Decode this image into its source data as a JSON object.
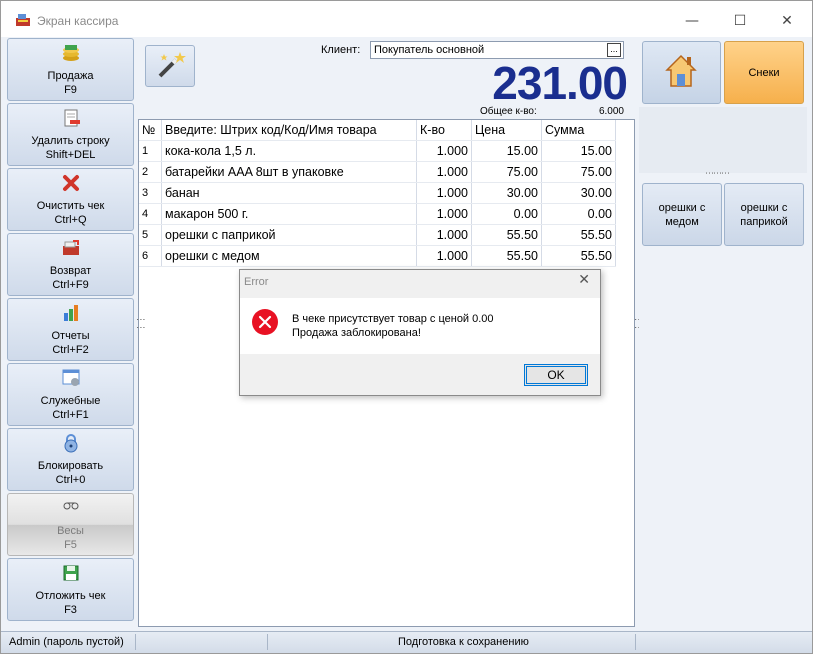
{
  "window": {
    "title": "Экран кассира",
    "minimize": "—",
    "maximize": "☐",
    "close": "✕"
  },
  "sidebar": {
    "items": [
      {
        "label": "Продажа",
        "shortcut": "F9"
      },
      {
        "label": "Удалить строку",
        "shortcut": "Shift+DEL"
      },
      {
        "label": "Очистить чек",
        "shortcut": "Ctrl+Q"
      },
      {
        "label": "Возврат",
        "shortcut": "Ctrl+F9"
      },
      {
        "label": "Отчеты",
        "shortcut": "Ctrl+F2"
      },
      {
        "label": "Служебные",
        "shortcut": "Ctrl+F1"
      },
      {
        "label": "Блокировать",
        "shortcut": "Ctrl+0"
      },
      {
        "label": "Весы",
        "shortcut": "F5"
      },
      {
        "label": "Отложить чек",
        "shortcut": "F3"
      }
    ]
  },
  "client": {
    "label": "Клиент:",
    "value": "Покупатель основной",
    "button": "..."
  },
  "total": {
    "amount": "231.00",
    "qty_label": "Общее к-во:",
    "qty_value": "6.000"
  },
  "table": {
    "headers": [
      "№",
      "Введите: Штрих код/Код/Имя товара",
      "К-во",
      "Цена",
      "Сумма"
    ],
    "rows": [
      [
        "1",
        "кока-кола 1,5 л.",
        "1.000",
        "15.00",
        "15.00"
      ],
      [
        "2",
        "батарейки AAA 8шт в упаковке",
        "1.000",
        "75.00",
        "75.00"
      ],
      [
        "3",
        "банан",
        "1.000",
        "30.00",
        "30.00"
      ],
      [
        "4",
        "макарон 500 г.",
        "1.000",
        "0.00",
        "0.00"
      ],
      [
        "5",
        "орешки с паприкой",
        "1.000",
        "55.50",
        "55.50"
      ],
      [
        "6",
        "орешки с медом",
        "1.000",
        "55.50",
        "55.50"
      ]
    ]
  },
  "right_panel": {
    "category_button": "Снеки",
    "products": [
      "орешки с медом",
      "орешки с паприкой"
    ]
  },
  "status": {
    "user": "Admin (пароль пустой)",
    "message": "Подготовка к сохранению"
  },
  "dialog": {
    "title": "Error",
    "close": "✕",
    "line1": "В чеке присутствует товар с ценой 0.00",
    "line2": "Продажа заблокирована!",
    "ok": "OK"
  }
}
